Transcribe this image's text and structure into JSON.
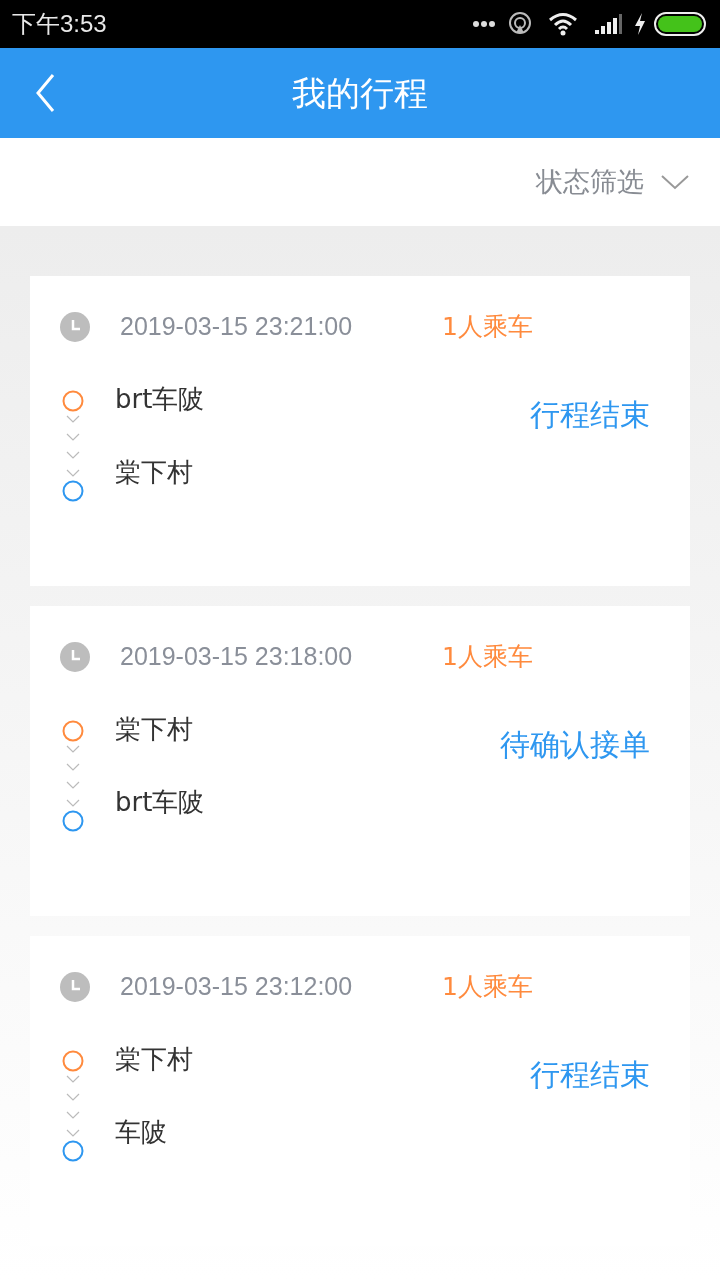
{
  "status_bar": {
    "time": "下午3:53"
  },
  "header": {
    "title": "我的行程"
  },
  "filter": {
    "label": "状态筛选"
  },
  "trips": [
    {
      "time": "2019-03-15 23:21:00",
      "passengers": "1人乘车",
      "from": "brt车陂",
      "to": "棠下村",
      "status": "行程结束"
    },
    {
      "time": "2019-03-15 23:18:00",
      "passengers": "1人乘车",
      "from": "棠下村",
      "to": "brt车陂",
      "status": "待确认接单"
    },
    {
      "time": "2019-03-15 23:12:00",
      "passengers": "1人乘车",
      "from": "棠下村",
      "to": "车陂",
      "status": "行程结束"
    }
  ]
}
